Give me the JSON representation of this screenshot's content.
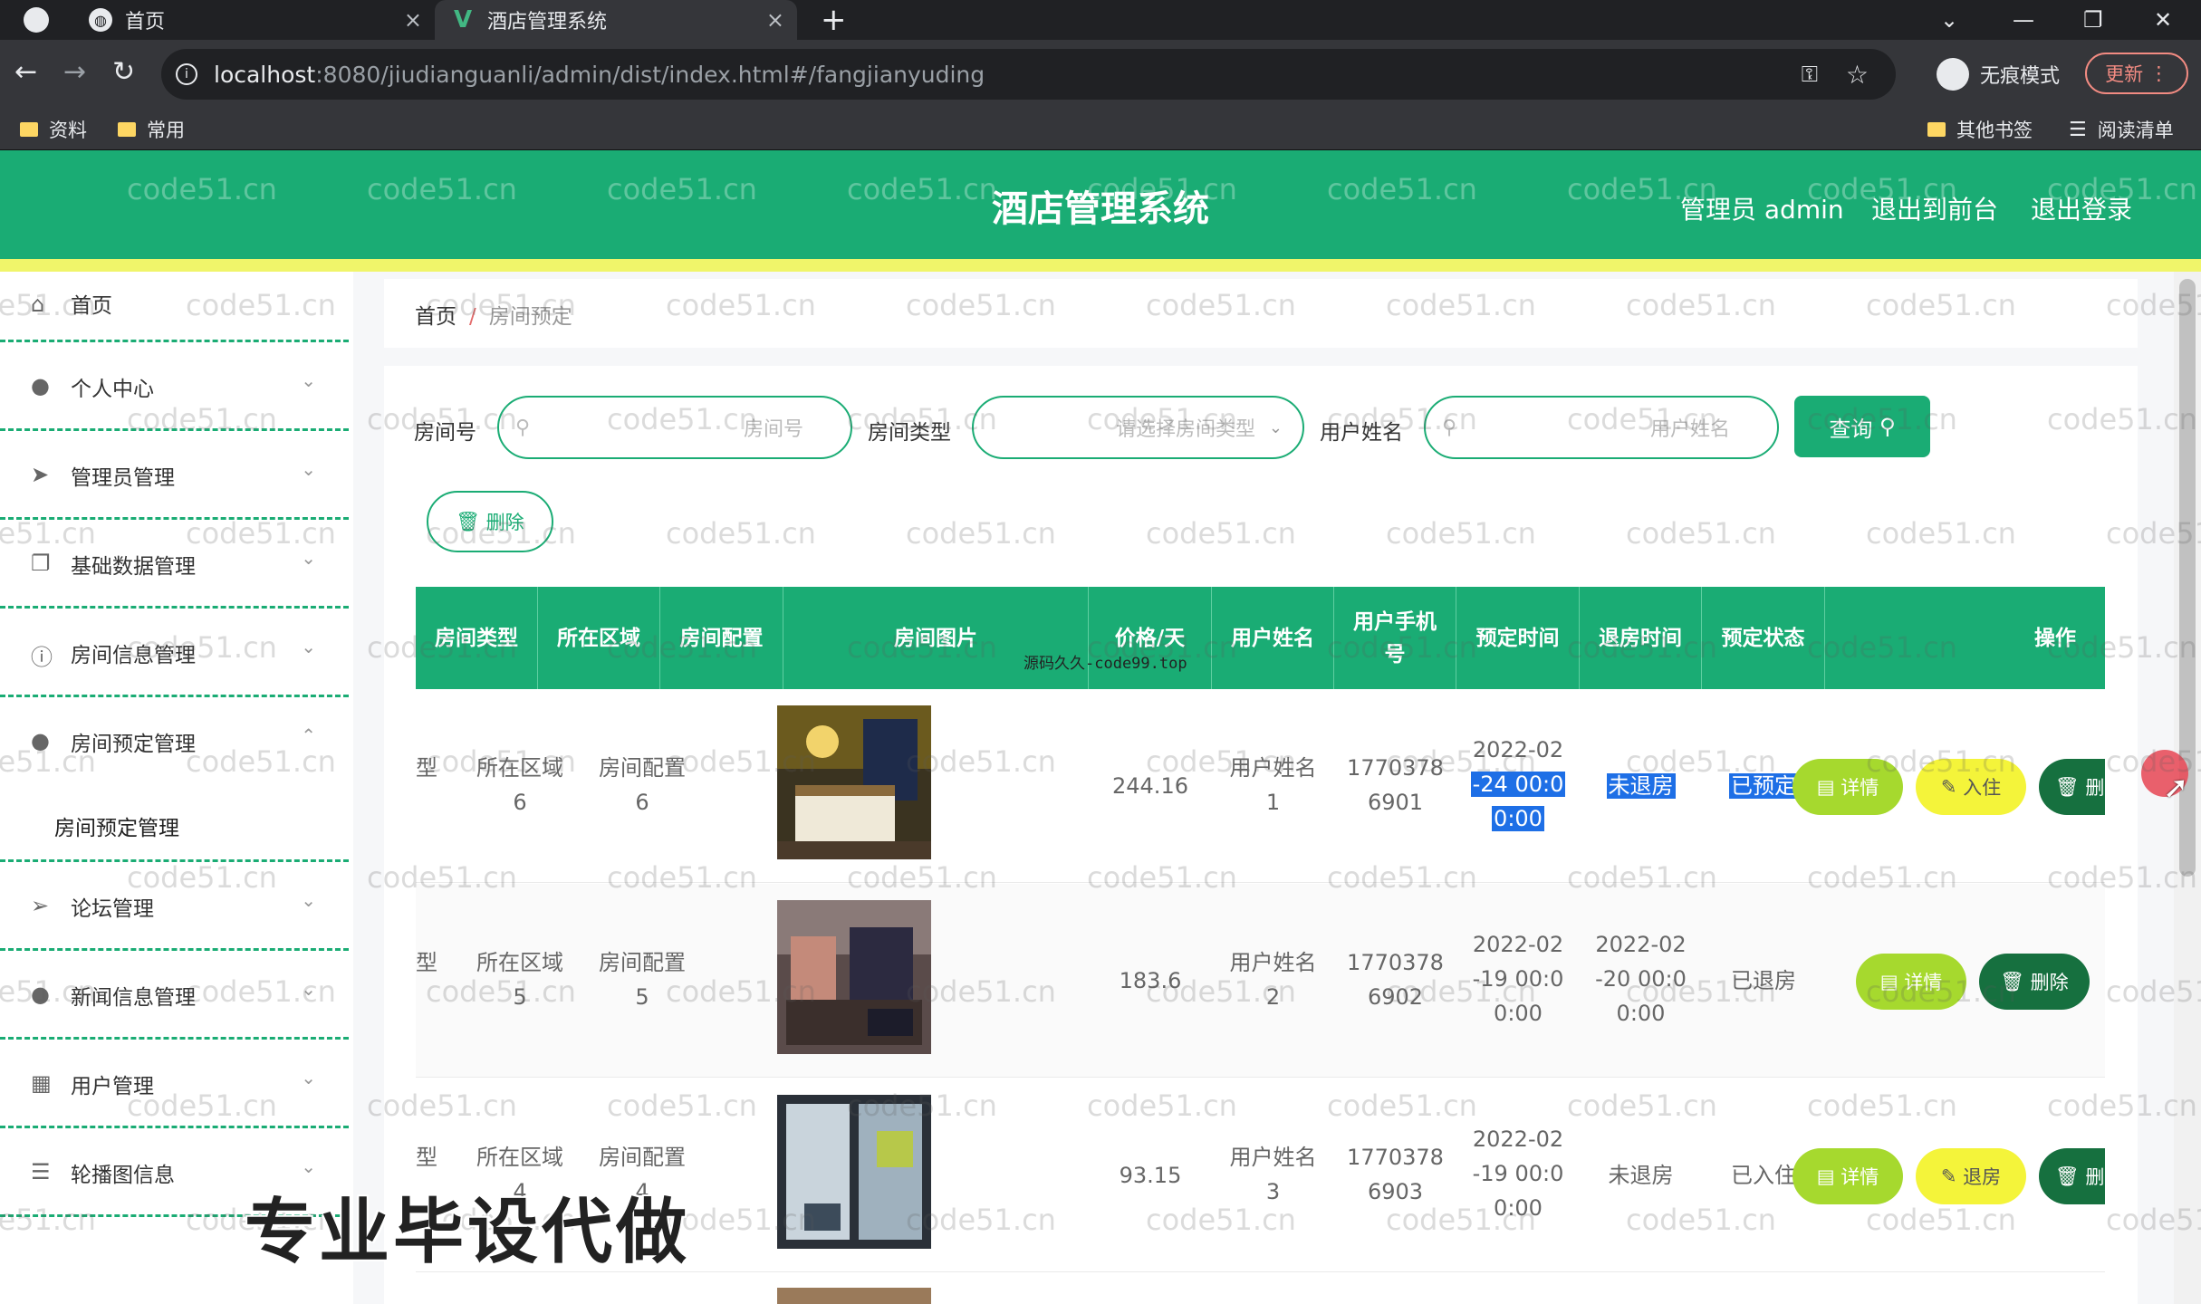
{
  "browser": {
    "tabs": [
      {
        "title": "首页",
        "active": false
      },
      {
        "title": "酒店管理系统",
        "active": true
      }
    ],
    "url_host": "localhost",
    "url_rest": ":8080/jiudianguanli/admin/dist/index.html#/fangjianyuding",
    "incognito_label": "无痕模式",
    "update_label": "更新",
    "bookmarks": [
      "资料",
      "常用"
    ],
    "bookmarks_right": [
      "其他书签",
      "阅读清单"
    ]
  },
  "header": {
    "title": "酒店管理系统",
    "admin_label": "管理员 admin",
    "front_link": "退出到前台",
    "logout_link": "退出登录",
    "brand_color": "#1aac74",
    "band_color": "#f0f56a"
  },
  "sidebar": {
    "items": [
      {
        "label": "首页",
        "icon": "home-icon"
      },
      {
        "label": "个人中心",
        "icon": "user-icon"
      },
      {
        "label": "管理员管理",
        "icon": "send-icon"
      },
      {
        "label": "基础数据管理",
        "icon": "copy-icon"
      },
      {
        "label": "房间信息管理",
        "icon": "info-icon"
      },
      {
        "label": "房间预定管理",
        "icon": "pin-icon"
      },
      {
        "label": "论坛管理",
        "icon": "location-icon"
      },
      {
        "label": "新闻信息管理",
        "icon": "user-icon"
      },
      {
        "label": "用户管理",
        "icon": "chart-icon"
      },
      {
        "label": "轮播图信息",
        "icon": "menu-icon"
      }
    ],
    "sub_item": "房间预定管理"
  },
  "breadcrumb": {
    "home": "首页",
    "current": "房间预定"
  },
  "filters": {
    "room_no_label": "房间号",
    "room_no_placeholder": "房间号",
    "room_type_label": "房间类型",
    "room_type_placeholder": "请选择房间类型",
    "user_name_label": "用户姓名",
    "user_name_placeholder": "用户姓名",
    "query_label": "查询",
    "delete_label": "删除"
  },
  "table": {
    "headers": [
      "房间类型",
      "所在区域",
      "房间配置",
      "房间图片",
      "价格/天",
      "用户姓名",
      "用户手机号",
      "预定时间",
      "退房时间",
      "预定状态",
      "操作"
    ],
    "rows": [
      {
        "type": "型",
        "area_a": "所在区域",
        "area_b": "6",
        "config_a": "房间配置",
        "config_b": "6",
        "price": "244.16",
        "user_a": "用户姓名",
        "user_b": "1",
        "phone_a": "1770378",
        "phone_b": "6901",
        "book_a": "2022-02",
        "book_b": "-24 00:0",
        "book_c": "0:00",
        "checkout_a": "未退房",
        "checkout_b": "",
        "checkout_c": "",
        "status": "已预定",
        "btn_detail": "详情",
        "btn_second": "入住",
        "btn_del": "删"
      },
      {
        "type": "型",
        "area_a": "所在区域",
        "area_b": "5",
        "config_a": "房间配置",
        "config_b": "5",
        "price": "183.6",
        "user_a": "用户姓名",
        "user_b": "2",
        "phone_a": "1770378",
        "phone_b": "6902",
        "book_a": "2022-02",
        "book_b": "-19 00:0",
        "book_c": "0:00",
        "checkout_a": "2022-02",
        "checkout_b": "-20 00:0",
        "checkout_c": "0:00",
        "status": "已退房",
        "btn_detail": "详情",
        "btn_del": "删除"
      },
      {
        "type": "型",
        "area_a": "所在区域",
        "area_b": "4",
        "config_a": "房间配置",
        "config_b": "4",
        "price": "93.15",
        "user_a": "用户姓名",
        "user_b": "3",
        "phone_a": "1770378",
        "phone_b": "6903",
        "book_a": "2022-02",
        "book_b": "-19 00:0",
        "book_c": "0:00",
        "checkout_a": "未退房",
        "checkout_b": "",
        "checkout_c": "",
        "status": "已入住",
        "btn_detail": "详情",
        "btn_second": "退房",
        "btn_del": "删"
      }
    ]
  },
  "overlay": {
    "watermark": "code51.cn",
    "small_watermark": "源码久久-code99.top",
    "banner": "专业毕设代做"
  }
}
